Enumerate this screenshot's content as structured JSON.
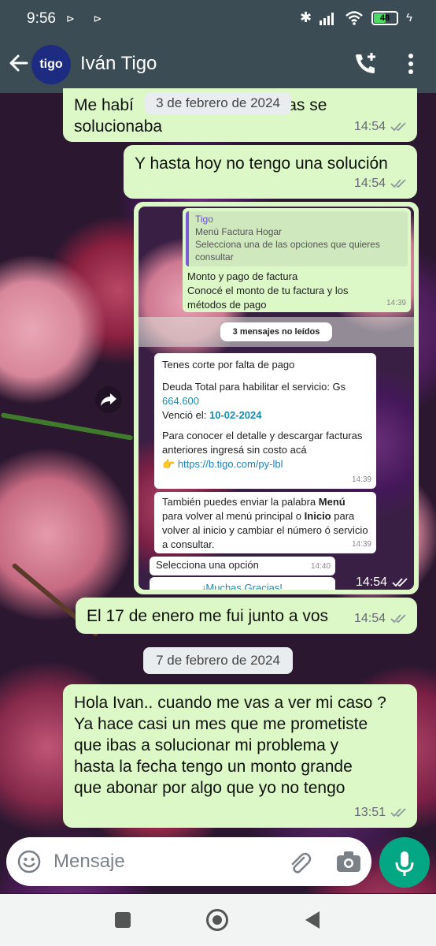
{
  "status_bar": {
    "time": "9:56",
    "left_icons": "⊳ ⊳",
    "battery": "48"
  },
  "header": {
    "contact_name": "Iván Tigo",
    "avatar_text": "tigo"
  },
  "chat": {
    "msg1": {
      "text_before": "Me habí",
      "text_after": "horas se",
      "line2": "solucionaba",
      "time": "14:54"
    },
    "date_chip_1": "3 de febrero de 2024",
    "msg2": {
      "text": "Y hasta hoy no tengo una solución",
      "time": "14:54"
    },
    "screenshot": {
      "quote_sender": "Tigo",
      "quote_line1": "Menú Factura Hogar",
      "quote_line2": "Selecciona una de las opciones que quieres consultar",
      "reply_line1": "Monto y pago de factura",
      "reply_line2": "Conocé el monto de tu factura y los métodos de pago",
      "reply_time": "14:39",
      "unread": "3 mensajes no leídos",
      "m1_line1": "Tenes corte por falta de pago",
      "m1_debt_label": "Deuda Total para habilitar el servicio: Gs",
      "m1_debt_value": "664.600",
      "m1_due_label": "Venció el:",
      "m1_due_value": "10-02-2024",
      "m1_info": "Para conocer el detalle y descargar facturas anteriores ingresá sin costo acá",
      "m1_link": "https://b.tigo.com/py-lbl",
      "m1_time": "14:39",
      "m2_p1": "También puedes enviar la palabra",
      "m2_b1": "Menú",
      "m2_p2": "para volver al menú principal o",
      "m2_b2": "Inicio",
      "m2_p3": "para volver al inicio y cambiar el número ó servicio a consultar.",
      "m2_time": "14:39",
      "m3_text": "Selecciona una opción",
      "m3_time": "14:40",
      "button": "¡Muchas Gracias!",
      "time": "14:54"
    },
    "msg3": {
      "text": "El 17 de enero me fui junto a vos",
      "time": "14:54"
    },
    "date_chip_2": "7 de febrero de 2024",
    "msg4": {
      "lines": [
        "Hola Ivan.. cuando me vas a ver mi caso ?",
        "Ya hace casi un mes que me prometiste",
        "que ibas a solucionar mi problema y",
        "hasta la fecha tengo un monto grande",
        "que abonar por algo que yo no tengo"
      ],
      "time": "13:51"
    }
  },
  "input": {
    "placeholder": "Mensaje"
  },
  "colors": {
    "header": "#3b4c55",
    "bubble_out": "#dcf8c6",
    "accent": "#04a784"
  }
}
